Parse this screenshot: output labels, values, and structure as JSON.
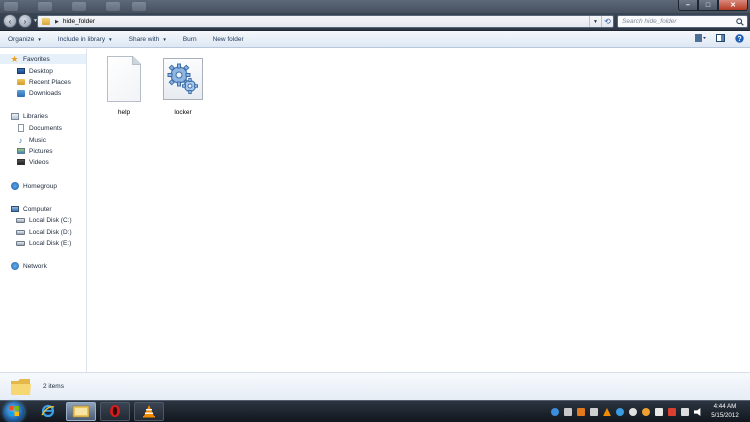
{
  "window": {
    "title": "hide_folder",
    "controls": {
      "minimize": "–",
      "maximize": "□",
      "close": "✕"
    }
  },
  "navigation": {
    "back_icon": "back-arrow-icon",
    "forward_icon": "forward-arrow-icon"
  },
  "address_bar": {
    "path": "hide_folder",
    "dropdown_icon": "chevron-down-icon",
    "refresh_icon": "refresh-icon"
  },
  "search": {
    "placeholder": "Search hide_folder"
  },
  "toolbar": {
    "items": [
      {
        "label": "Organize",
        "dropdown": true
      },
      {
        "label": "Include in library",
        "dropdown": true
      },
      {
        "label": "Share with",
        "dropdown": true
      },
      {
        "label": "Burn",
        "dropdown": false
      },
      {
        "label": "New folder",
        "dropdown": false
      }
    ],
    "right_icons": [
      "change-view-icon",
      "preview-pane-icon",
      "help-icon"
    ]
  },
  "nav_pane": {
    "favorites": {
      "label": "Favorites",
      "items": [
        "Desktop",
        "Recent Places",
        "Downloads"
      ]
    },
    "libraries": {
      "label": "Libraries",
      "items": [
        "Documents",
        "Music",
        "Pictures",
        "Videos"
      ]
    },
    "homegroup": {
      "label": "Homegroup"
    },
    "computer": {
      "label": "Computer",
      "items": [
        "Local Disk (C:)",
        "Local Disk (D:)",
        "Local Disk (E:)"
      ]
    },
    "network": {
      "label": "Network"
    }
  },
  "files": [
    {
      "name": "help",
      "type": "text-document",
      "icon": "text-document-icon"
    },
    {
      "name": "locker",
      "type": "batch-file",
      "icon": "batch-file-gears-icon"
    }
  ],
  "details": {
    "item_count": "2 items"
  },
  "taskbar": {
    "apps": [
      "internet-explorer",
      "windows-explorer",
      "opera",
      "vlc"
    ],
    "active_app": "windows-explorer",
    "clock_time": "4:44 AM",
    "clock_date": "5/15/2012"
  },
  "colors": {
    "titlebar": "#3b4656",
    "toolbar_text": "#1e395b",
    "selected_nav": "#e6f0fb",
    "taskbar": "#1b222b"
  }
}
